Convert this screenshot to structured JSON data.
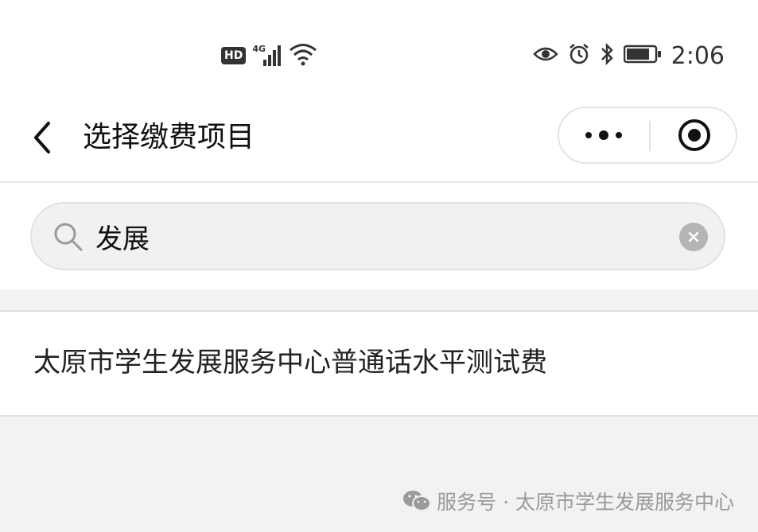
{
  "status_bar": {
    "hd_label": "HD",
    "network_label": "4G",
    "time": "2:06",
    "icons": [
      "hd-icon",
      "signal-icon",
      "wifi-icon",
      "eye-icon",
      "alarm-icon",
      "bluetooth-icon",
      "battery-icon"
    ]
  },
  "navbar": {
    "title": "选择缴费项目",
    "back_icon": "chevron-left-icon",
    "more_icon": "more-dots-icon",
    "close_icon": "target-circle-icon"
  },
  "search": {
    "value": "发展",
    "placeholder": "",
    "icon": "search-icon",
    "clear_icon": "clear-icon"
  },
  "results": [
    {
      "label": "太原市学生发展服务中心普通话水平测试费"
    }
  ],
  "watermark": {
    "icon": "wechat-icon",
    "text": "服务号 · 太原市学生发展服务中心"
  },
  "colors": {
    "background": "#f2f2f2",
    "surface": "#ffffff",
    "text": "#1a1a1a",
    "muted": "#9a9a9a",
    "clear_button": "#b5b5b5"
  }
}
